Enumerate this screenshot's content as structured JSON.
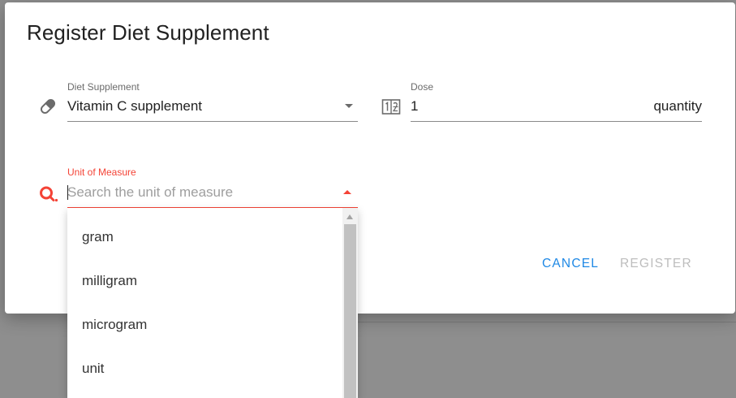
{
  "dialog": {
    "title": "Register Diet Supplement"
  },
  "fields": {
    "supplement": {
      "label": "Diet Supplement",
      "value": "Vitamin C supplement",
      "icon": "pill-icon"
    },
    "dose": {
      "label": "Dose",
      "value": "1",
      "suffix": "quantity",
      "icon": "number-icon"
    },
    "unit": {
      "label": "Unit of Measure",
      "placeholder": "Search the unit of measure",
      "value": "",
      "icon": "search-icon"
    }
  },
  "actions": {
    "cancel": "CANCEL",
    "register": "REGISTER"
  },
  "dropdown": {
    "options": [
      "gram",
      "milligram",
      "microgram",
      "unit"
    ]
  },
  "colors": {
    "accent": "#f44336",
    "primary": "#1e88e5",
    "disabled": "#bdbdbd",
    "backdrop": "#8e8e8e"
  }
}
